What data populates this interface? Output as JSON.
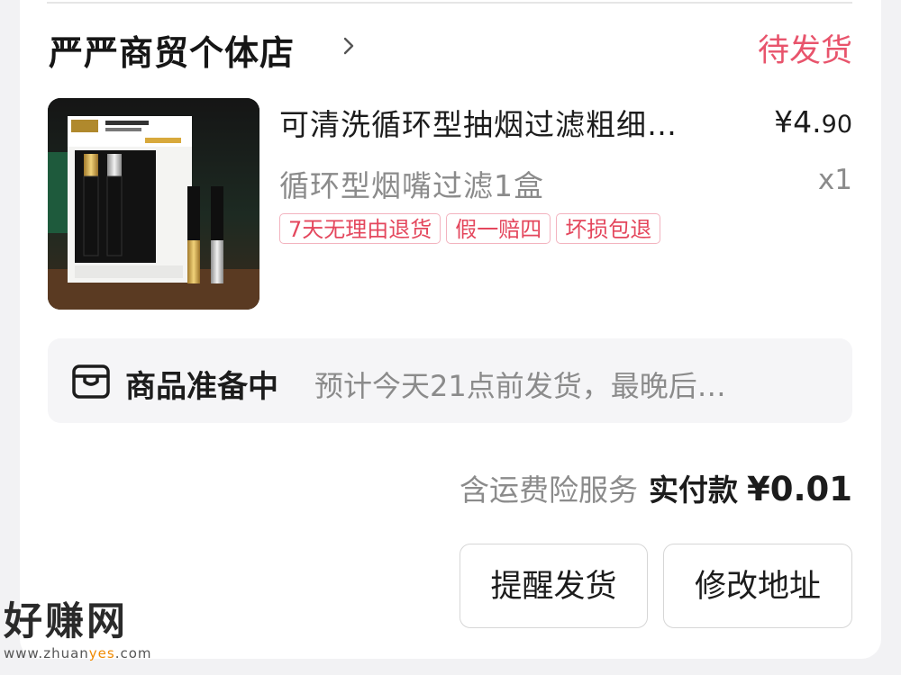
{
  "order": {
    "shop_name": "严严商贸个体店",
    "status": "待发货",
    "product": {
      "title": "可清洗循环型抽烟过滤粗细…",
      "price_main": "¥4.",
      "price_cents": "90",
      "spec": "循环型烟嘴过滤1盒",
      "quantity": "x1",
      "tags": [
        "7天无理由退货",
        "假一赔四",
        "坏损包退"
      ]
    },
    "logistics": {
      "status": "商品准备中",
      "eta": "预计今天21点前发货，最晚后…"
    },
    "payment": {
      "insurance": "含运费险服务",
      "paid_label": "实付款",
      "paid_amount": "¥0.01"
    },
    "buttons": {
      "remind": "提醒发货",
      "address": "修改地址"
    }
  },
  "watermark": {
    "title": "好赚网",
    "url_prefix": "www.zhuan",
    "url_highlight": "yes",
    "url_suffix": ".com"
  },
  "colors": {
    "status_pink": "#e8546c",
    "tag_text": "#e4475d",
    "tag_border": "#f3b3bf",
    "muted_text": "#8b8b8b",
    "logistics_bg": "#f5f5f7"
  }
}
